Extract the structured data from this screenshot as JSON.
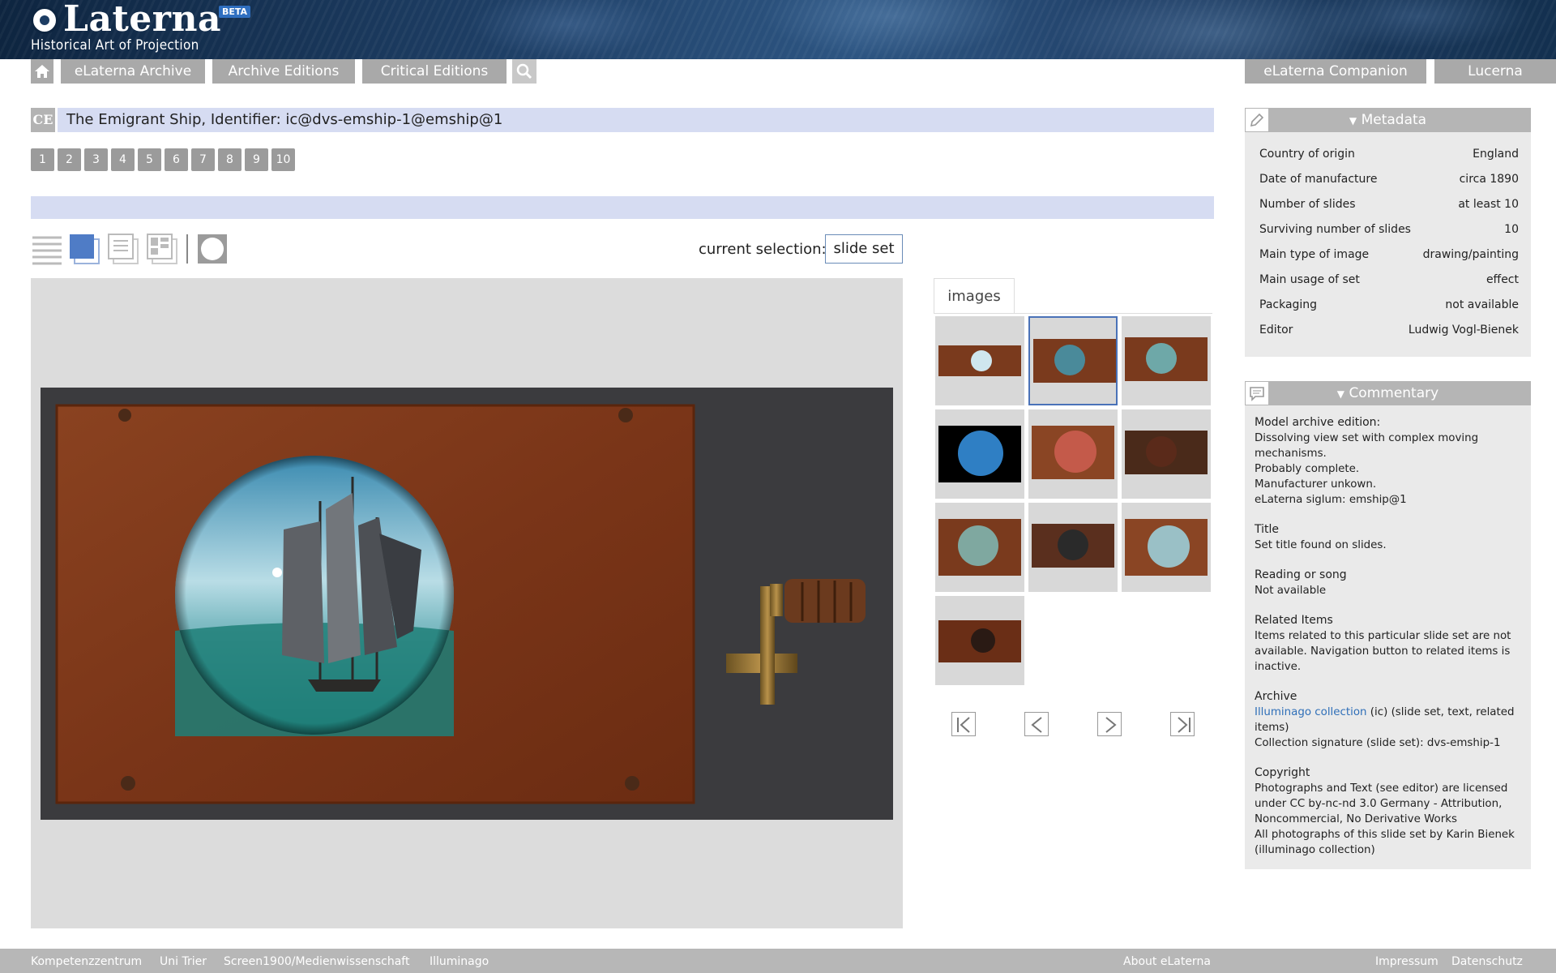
{
  "header": {
    "logo_title": "Laterna",
    "beta_badge": "BETA",
    "subtitle": "Historical Art of Projection"
  },
  "nav": {
    "home_icon": "home-icon",
    "tabs": [
      "eLaterna Archive",
      "Archive Editions",
      "Critical Editions"
    ],
    "search_icon": "search-icon",
    "right_tabs": [
      "eLaterna Companion",
      "Lucerna"
    ]
  },
  "record": {
    "badge": "CE",
    "title": "The Emigrant Ship, Identifier: ic@dvs-emship-1@emship@1",
    "pages": [
      "1",
      "2",
      "3",
      "4",
      "5",
      "6",
      "7",
      "8",
      "9",
      "10"
    ]
  },
  "toolbar": {
    "selection_label": "current selection:",
    "selection_value": "slide set",
    "view_icons": [
      "list-view-icon",
      "single-view-icon",
      "text-view-icon",
      "compare-view-icon",
      "circle-view-icon"
    ]
  },
  "images_tab": "images",
  "pager_icons": [
    "first-icon",
    "prev-icon",
    "next-icon",
    "last-icon"
  ],
  "colors": {
    "accent_blue": "#d6dcf2",
    "nav_grey": "#a9a9a9",
    "link_blue": "#2f6fb8",
    "slide_wood": "#7a3a1d"
  },
  "metadata": {
    "heading": "Metadata",
    "rows": [
      {
        "k": "Country of origin",
        "v": "England"
      },
      {
        "k": "Date of manufacture",
        "v": "circa 1890"
      },
      {
        "k": "Number of slides",
        "v": "at least 10"
      },
      {
        "k": "Surviving number of slides",
        "v": "10"
      },
      {
        "k": "Main type of image",
        "v": "drawing/painting"
      },
      {
        "k": "Main usage of set",
        "v": "effect"
      },
      {
        "k": "Packaging",
        "v": "not available"
      },
      {
        "k": "Editor",
        "v": "Ludwig Vogl-Bienek"
      }
    ]
  },
  "commentary": {
    "heading": "Commentary",
    "model_head": "Model archive edition:",
    "model_lines": [
      "Dissolving view set with complex moving mechanisms.",
      "Probably complete.",
      "Manufacturer unkown.",
      "eLaterna siglum: emship@1"
    ],
    "title_head": "Title",
    "title_text": "Set title found on slides.",
    "reading_head": "Reading or song",
    "reading_text": "Not available",
    "related_head": "Related Items",
    "related_text": "Items related to this particular slide set are not available. Navigation button to related items is inactive.",
    "archive_head": "Archive",
    "archive_link": "Illuminago collection",
    "archive_rest": " (ic) (slide set, text, related items)",
    "archive_sig": "Collection signature (slide set): dvs-emship-1",
    "copyright_head": "Copyright",
    "copyright_text": "Photographs and Text (see editor) are licensed under CC by-nc-nd 3.0 Germany - Attribution, Noncommercial, No Derivative Works",
    "copyright_photo": "All photographs of this slide set by Karin Bienek (illuminago collection)"
  },
  "footer": {
    "left": [
      "Kompetenzzentrum",
      "Uni Trier",
      "Screen1900/Medienwissenschaft",
      "Illuminago"
    ],
    "middle": "About eLaterna",
    "right": [
      "Impressum",
      "Datenschutz"
    ]
  }
}
